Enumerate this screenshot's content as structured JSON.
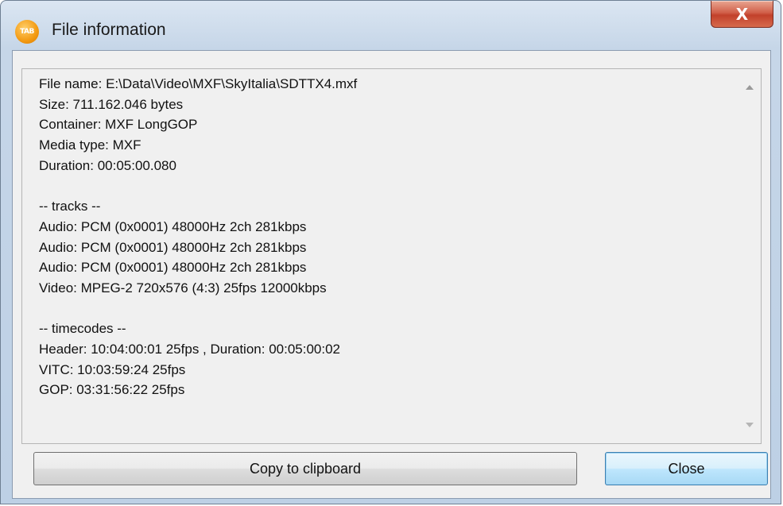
{
  "window": {
    "title": "File information",
    "app_icon_text": "TAB",
    "close_glyph": "X"
  },
  "info": {
    "lines": [
      "File name: E:\\Data\\Video\\MXF\\SkyItalia\\SDTTX4.mxf",
      "Size: 711.162.046 bytes",
      "Container: MXF LongGOP",
      "Media type: MXF",
      "Duration: 00:05:00.080",
      "",
      "-- tracks --",
      "Audio: PCM (0x0001) 48000Hz 2ch 281kbps",
      "Audio: PCM (0x0001) 48000Hz 2ch 281kbps",
      "Audio: PCM (0x0001) 48000Hz 2ch 281kbps",
      "Video: MPEG-2 720x576 (4:3) 25fps 12000kbps",
      "",
      "-- timecodes --",
      "Header: 10:04:00:01 25fps , Duration: 00:05:00:02",
      "VITC: 10:03:59:24 25fps",
      "GOP: 03:31:56:22 25fps"
    ]
  },
  "buttons": {
    "copy_label": "Copy to clipboard",
    "close_label": "Close"
  },
  "icons": {
    "scroll_up": "scroll-up-arrow-icon",
    "scroll_down": "scroll-down-arrow-icon"
  }
}
